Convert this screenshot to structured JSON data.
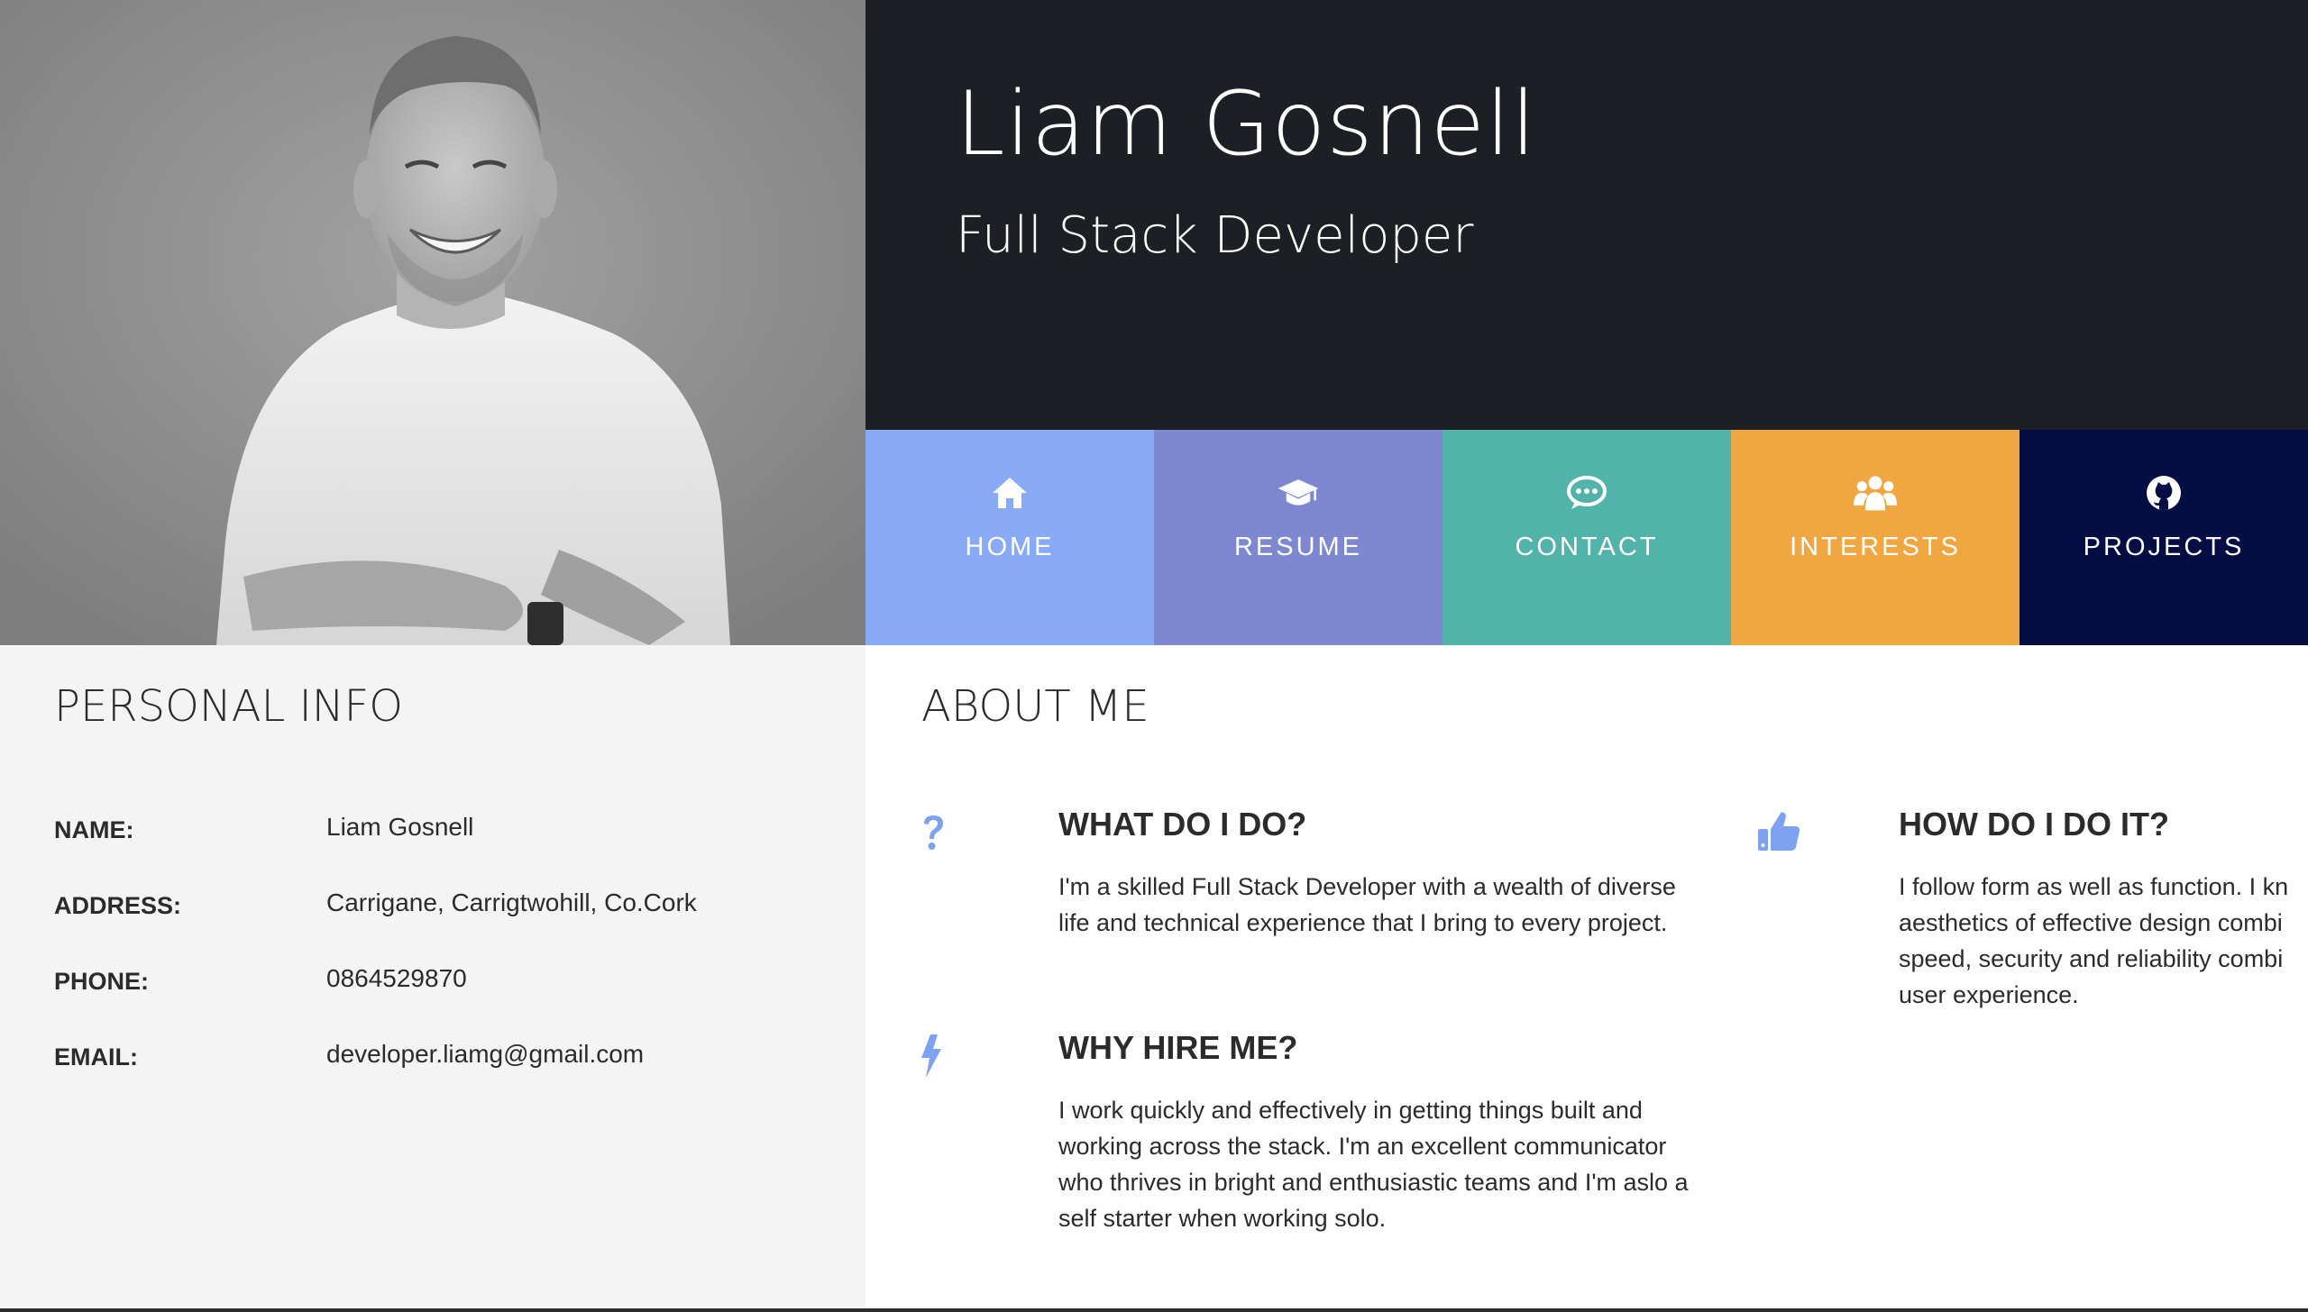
{
  "header": {
    "name": "Liam Gosnell",
    "title": "Full Stack Developer",
    "background": "#1e1f24"
  },
  "nav": {
    "items": [
      {
        "label": "HOME",
        "icon": "home-icon",
        "color": "#89aaf6"
      },
      {
        "label": "RESUME",
        "icon": "graduation-cap-icon",
        "color": "#7e88d0"
      },
      {
        "label": "CONTACT",
        "icon": "chat-bubble-icon",
        "color": "#51b3a9"
      },
      {
        "label": "INTERESTS",
        "icon": "users-icon",
        "color": "#f0a641"
      },
      {
        "label": "PROJECTS",
        "icon": "github-icon",
        "color": "#040d44"
      }
    ]
  },
  "personal": {
    "heading": "PERSONAL INFO",
    "rows": [
      {
        "label": "NAME:",
        "value": "Liam Gosnell"
      },
      {
        "label": "ADDRESS:",
        "value": "Carrigane, Carrigtwohill, Co.Cork"
      },
      {
        "label": "PHONE:",
        "value": "0864529870"
      },
      {
        "label": "EMAIL:",
        "value": "developer.liamg@gmail.com"
      }
    ]
  },
  "about": {
    "heading": "ABOUT ME",
    "accent": "#7ea1f0",
    "blocks": [
      {
        "icon": "question-mark-icon",
        "title": "WHAT DO I DO?",
        "text": "I'm a skilled Full Stack Developer with a wealth of diverse life and technical experience that I bring to every project."
      },
      {
        "icon": "thumbs-up-icon",
        "title": "HOW DO I DO IT?",
        "text_lines": [
          "I follow form as well as function. I kn",
          "aesthetics of effective design combi",
          "speed, security and reliability combi",
          "user experience."
        ]
      },
      {
        "icon": "lightning-bolt-icon",
        "title": "WHY HIRE ME?",
        "text": "I work quickly and effectively in getting things built and working across the stack. I'm an excellent communicator who thrives in bright and enthusiastic teams and I'm aslo a self starter when working solo."
      }
    ]
  }
}
